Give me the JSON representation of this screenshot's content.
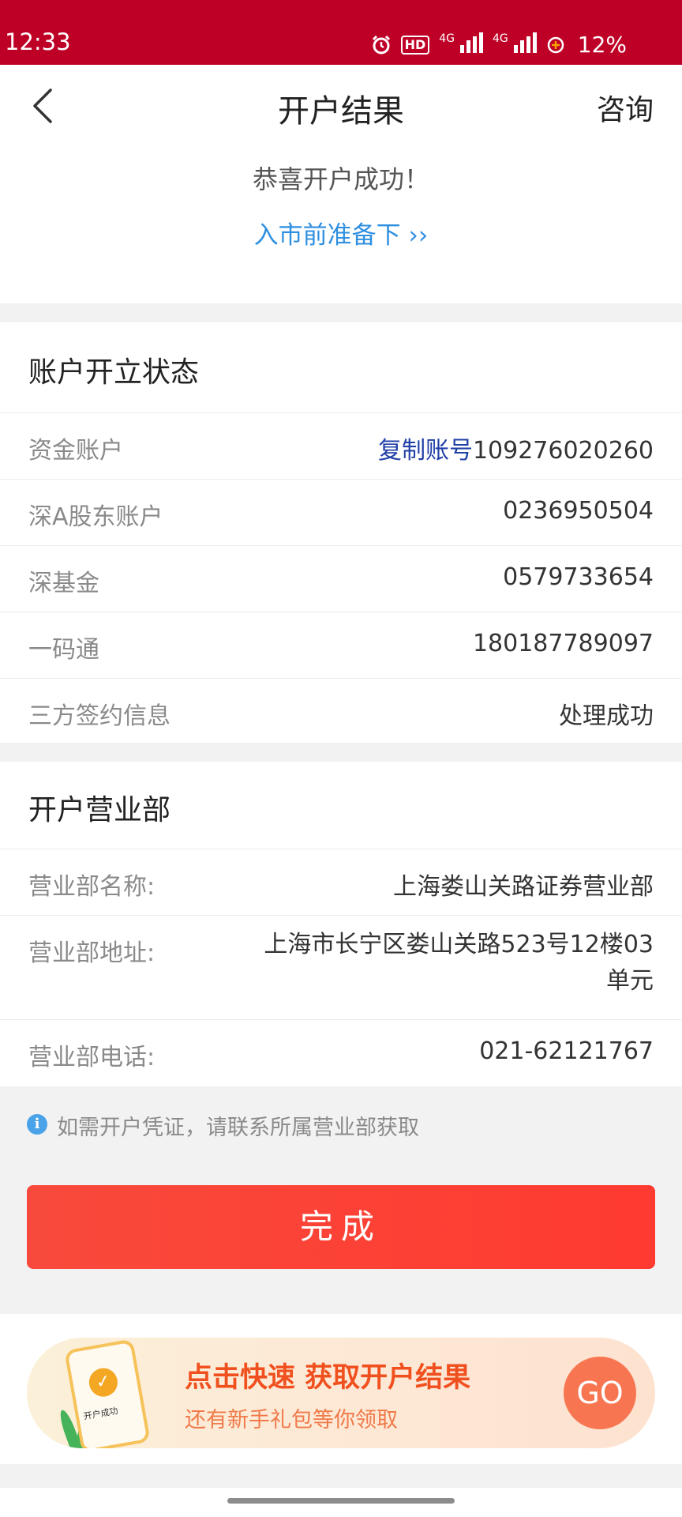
{
  "status_bar": {
    "time": "12:33",
    "hd_label": "HD",
    "net1": "4G",
    "net2": "4G",
    "battery": "12%"
  },
  "nav": {
    "title": "开户结果",
    "consult": "咨询"
  },
  "hero": {
    "congrats": "恭喜开户成功！",
    "prepare_link": "入市前准备下 ››"
  },
  "account_status": {
    "title": "账户开立状态",
    "rows": [
      {
        "label": "资金账户",
        "copy": "复制账号",
        "value": "109276020260"
      },
      {
        "label": "深A股东账户",
        "value": "0236950504"
      },
      {
        "label": "深基金",
        "value": "0579733654"
      },
      {
        "label": "一码通",
        "value": "180187789097"
      },
      {
        "label": "三方签约信息",
        "value": "处理成功"
      }
    ]
  },
  "branch": {
    "title": "开户营业部",
    "rows": [
      {
        "label": "营业部名称:",
        "value": "上海娄山关路证券营业部"
      },
      {
        "label": "营业部地址:",
        "value_line1": "上海市长宁区娄山关路523号12楼03",
        "value_line2": "单元"
      },
      {
        "label": "营业部电话:",
        "value": "021-62121767"
      }
    ]
  },
  "notice": {
    "icon": "info-icon",
    "text": "如需开户凭证，请联系所属营业部获取",
    "done_button": "完成"
  },
  "banner": {
    "title": "点击快速 获取开户结果",
    "subtitle": "还有新手礼包等你领取",
    "phone_text": "开户成功",
    "go": "GO"
  },
  "colors": {
    "status_bar": "#bf0026",
    "link_blue": "#2f8fe0",
    "copy_blue": "#1f3fa6",
    "button_red": "#f84a3c",
    "banner_orange": "#f0501e"
  }
}
